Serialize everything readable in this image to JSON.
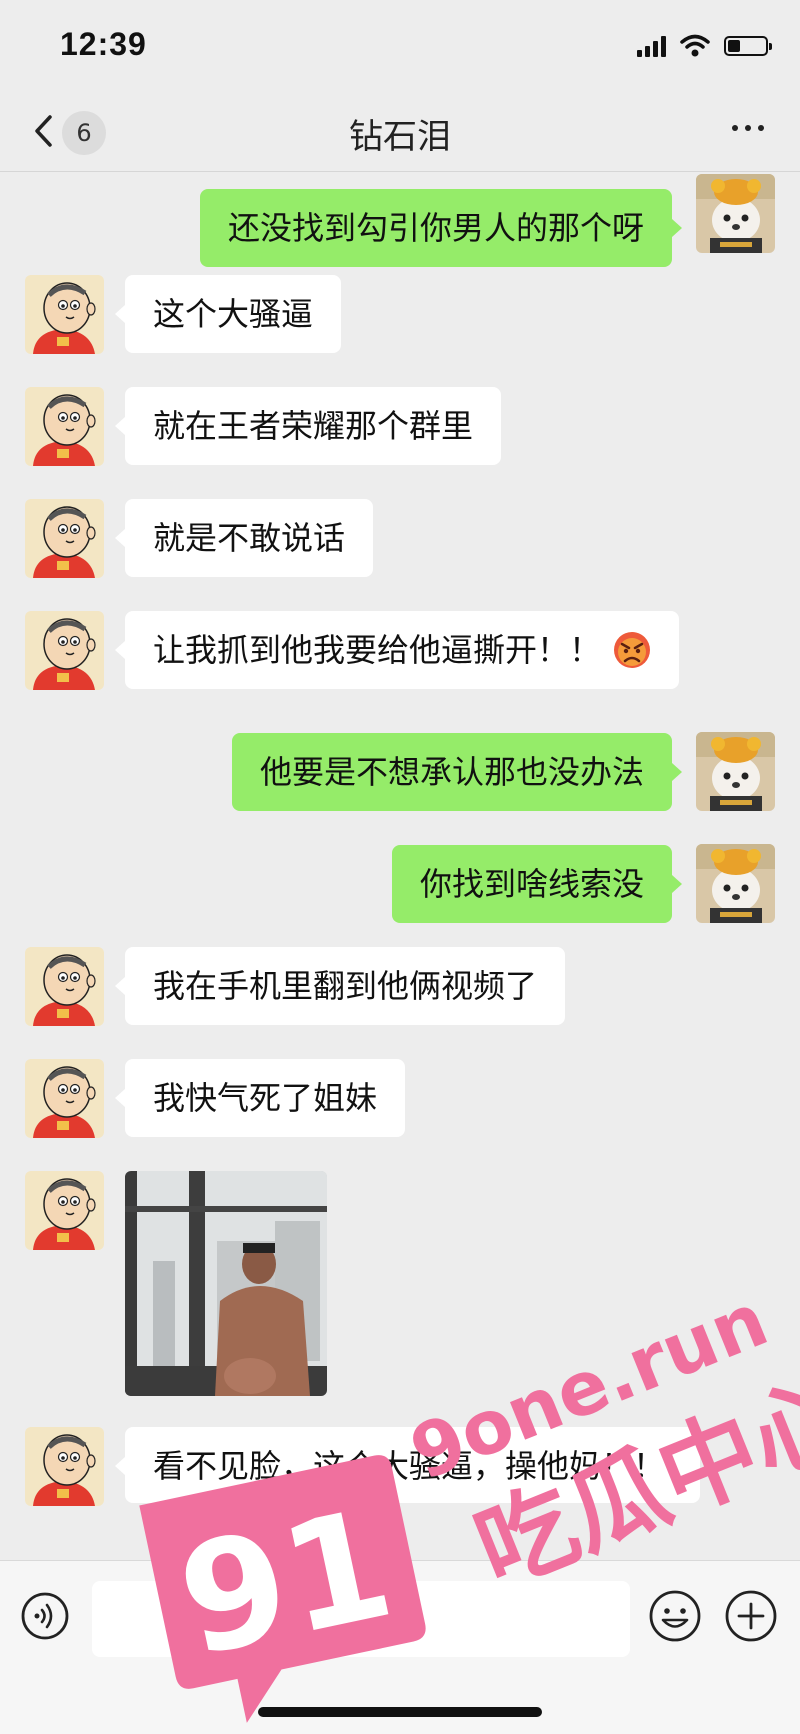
{
  "status_bar": {
    "time": "12:39"
  },
  "nav": {
    "unread_count": "6",
    "title": "钻石泪"
  },
  "messages": [
    {
      "side": "out",
      "text": "还没找到勾引你男人的那个呀"
    },
    {
      "side": "in",
      "text": "这个大骚逼"
    },
    {
      "side": "in",
      "text": "就在王者荣耀那个群里"
    },
    {
      "side": "in",
      "text": "就是不敢说话"
    },
    {
      "side": "in",
      "text": "让我抓到他我要给他逼撕开！！",
      "emoji": "angry-face-emoji"
    },
    {
      "side": "out",
      "text": "他要是不想承认那也没办法"
    },
    {
      "side": "out",
      "text": "你找到啥线索没"
    },
    {
      "side": "in",
      "text": "我在手机里翻到他俩视频了"
    },
    {
      "side": "in",
      "text": "我快气死了姐妹"
    },
    {
      "side": "in",
      "type": "image"
    },
    {
      "side": "in",
      "text": "看不见脸，这个大骚逼，操他妈！！"
    }
  ],
  "input": {
    "placeholder": ""
  },
  "watermark": {
    "number": "91",
    "domain": "9one.run",
    "label": "吃瓜中心"
  },
  "colors": {
    "outgoing_bubble": "#95ec69",
    "incoming_bubble": "#ffffff",
    "background": "#ededed",
    "watermark": "#f0709e"
  }
}
